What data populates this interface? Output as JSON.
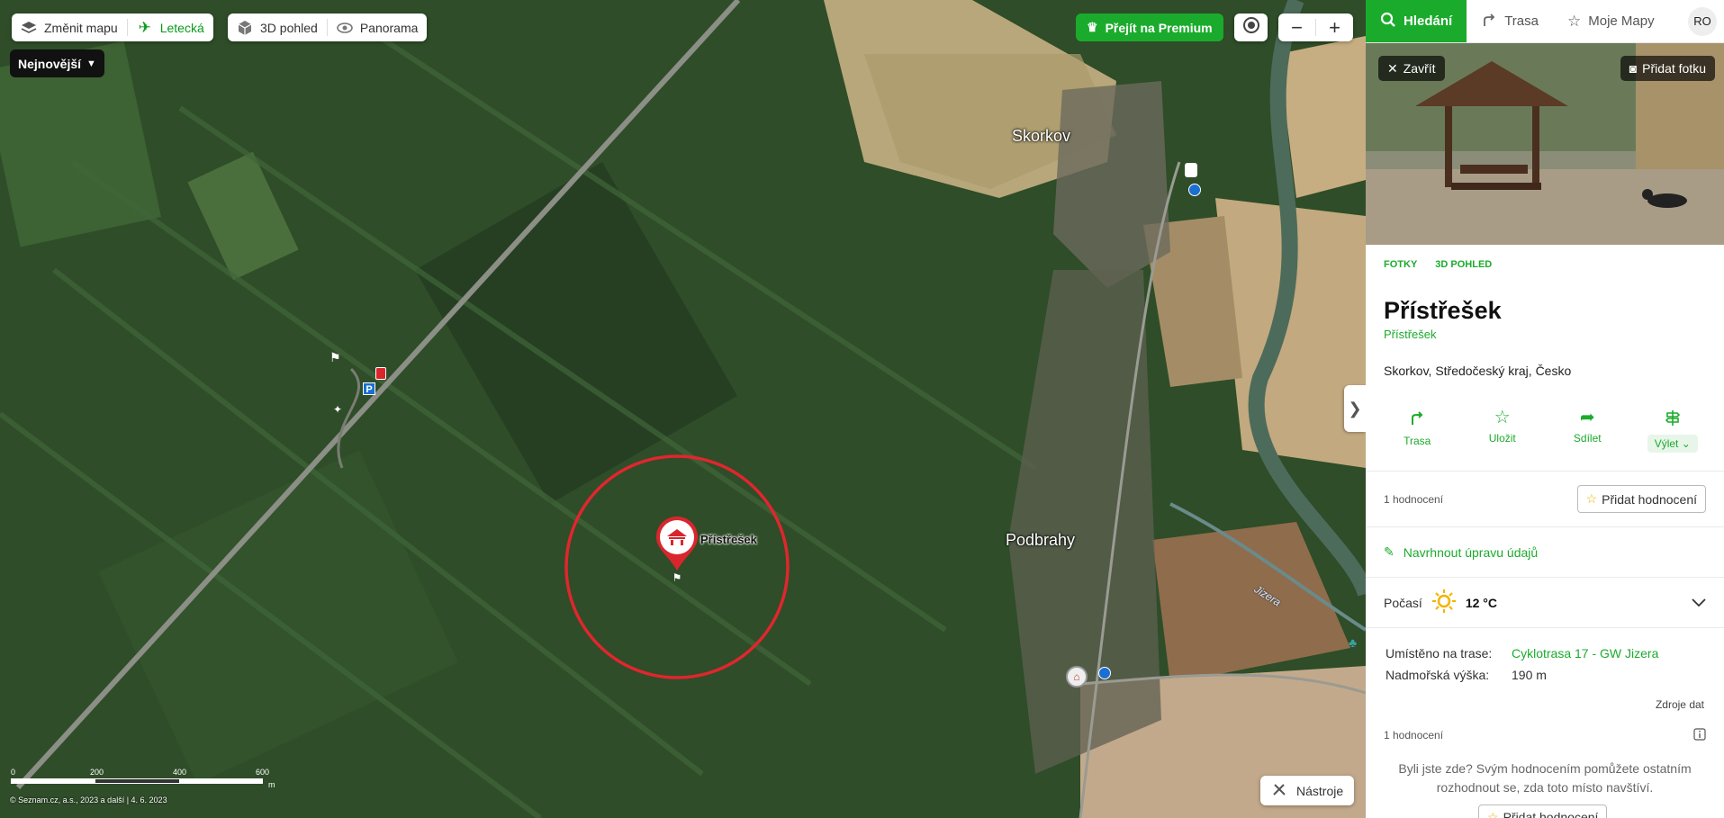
{
  "map": {
    "layers": {
      "change_map_label": "Změnit mapu",
      "aerial_label": "Letecká"
    },
    "views": {
      "view3d_label": "3D pohled",
      "panorama_label": "Panorama"
    },
    "newest_label": "Nejnovější",
    "premium_label": "Přejít na Premium",
    "zoom": {
      "out": "−",
      "in": "+"
    },
    "places": [
      "Skorkov",
      "Podbrahy"
    ],
    "river_label": "Jizera",
    "pin_label": "Přístřešek",
    "scale": {
      "ticks": [
        "0",
        "200",
        "400",
        "600"
      ],
      "unit": "m"
    },
    "copyright": "© Seznam.cz, a.s., 2023 a další | 4. 6. 2023",
    "tools_label": "Nástroje",
    "collapse_icon": "chevron-right-icon"
  },
  "panel": {
    "tabs": [
      {
        "label": "Hledání",
        "icon": "search-icon"
      },
      {
        "label": "Trasa",
        "icon": "route-icon"
      },
      {
        "label": "Moje Mapy",
        "icon": "star-icon"
      }
    ],
    "avatar": "RO",
    "photo": {
      "close_label": "Zavřít",
      "add_photo_label": "Přidat fotku"
    },
    "media_tabs": [
      "FOTKY",
      "3D POHLED"
    ],
    "title": "Přístřešek",
    "subtitle": "Přístřešek",
    "address": "Skorkov, Středočeský kraj, Česko",
    "actions": [
      {
        "label": "Trasa",
        "icon": "route-icon"
      },
      {
        "label": "Uložit",
        "icon": "star-icon"
      },
      {
        "label": "Sdílet",
        "icon": "share-icon"
      },
      {
        "label": "Výlet",
        "icon": "signpost-icon"
      }
    ],
    "rating": {
      "count_label": "1 hodnocení",
      "add_label": "Přidat hodnocení"
    },
    "suggest_label": "Navrhnout úpravu údajů",
    "weather": {
      "label": "Počasí",
      "temp": "12 °C",
      "icon": "sun-icon"
    },
    "info": [
      {
        "key": "Umístěno na trase:",
        "value": "Cyklotrasa 17 - GW Jizera"
      },
      {
        "key": "Nadmořská výška:",
        "value": "190 m"
      }
    ],
    "sources_label": "Zdroje dat",
    "rating2": {
      "count_label": "1 hodnocení"
    },
    "prompt": "Byli jste zde? Svým hodnocením pomůžete ostatním rozhodnout se, zda toto místo navštíví.",
    "add_rating2_label": "Přidat hodnocení"
  },
  "colors": {
    "accent": "#1bab2c",
    "marker": "#d9262d"
  }
}
